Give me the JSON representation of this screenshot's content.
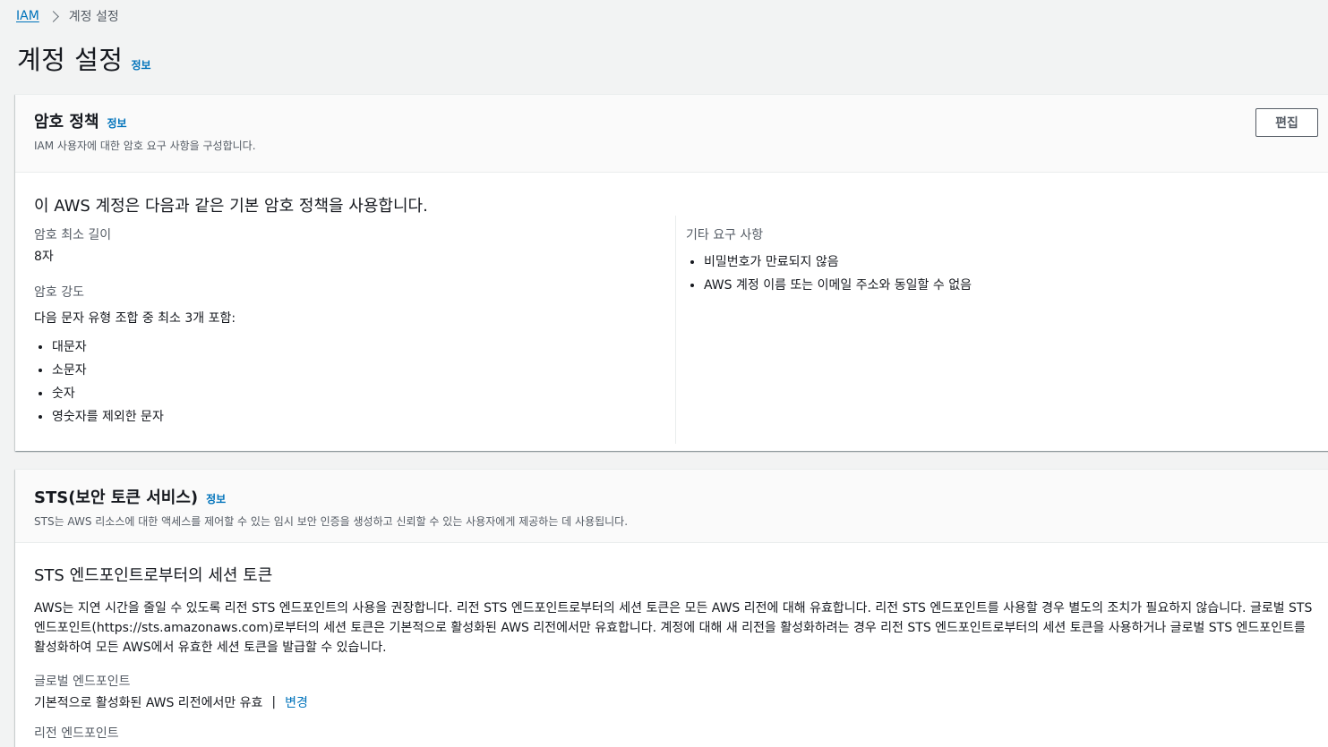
{
  "breadcrumb": {
    "root": "IAM",
    "current": "계정 설정"
  },
  "page": {
    "title": "계정 설정",
    "info": "정보"
  },
  "password_panel": {
    "title": "암호 정책",
    "info": "정보",
    "description": "IAM 사용자에 대한 암호 요구 사항을 구성합니다.",
    "edit_button": "편집",
    "heading": "이 AWS 계정은 다음과 같은 기본 암호 정책을 사용합니다.",
    "min_length_label": "암호 최소 길이",
    "min_length_value": "8자",
    "strength_label": "암호 강도",
    "strength_intro": "다음 문자 유형 조합 중 최소 3개 포함:",
    "strength_items": [
      "대문자",
      "소문자",
      "숫자",
      "영숫자를 제외한 문자"
    ],
    "other_label": "기타 요구 사항",
    "other_items": [
      "비밀번호가 만료되지 않음",
      "AWS 계정 이름 또는 이메일 주소와 동일할 수 없음"
    ]
  },
  "sts_panel": {
    "title": "STS(보안 토큰 서비스)",
    "info": "정보",
    "description": "STS는 AWS 리소스에 대한 액세스를 제어할 수 있는 임시 보안 인증을 생성하고 신뢰할 수 있는 사용자에게 제공하는 데 사용됩니다.",
    "heading": "STS 엔드포인트로부터의 세션 토큰",
    "paragraph": "AWS는 지연 시간을 줄일 수 있도록 리전 STS 엔드포인트의 사용을 권장합니다. 리전 STS 엔드포인트로부터의 세션 토큰은 모든 AWS 리전에 대해 유효합니다. 리전 STS 엔드포인트를 사용할 경우 별도의 조치가 필요하지 않습니다. 글로벌 STS 엔드포인트(https://sts.amazonaws.com)로부터의 세션 토큰은 기본적으로 활성화된 AWS 리전에서만 유효합니다. 계정에 대해 새 리전을 활성화하려는 경우 리전 STS 엔드포인트로부터의 세션 토큰을 사용하거나 글로벌 STS 엔드포인트를 활성화하여 모든 AWS에서 유효한 세션 토큰을 발급할 수 있습니다.",
    "global_label": "글로벌 엔드포인트",
    "global_value": "기본적으로 활성화된 AWS 리전에서만 유효",
    "global_separator": "|",
    "global_change": "변경",
    "regional_label": "리전 엔드포인트"
  }
}
